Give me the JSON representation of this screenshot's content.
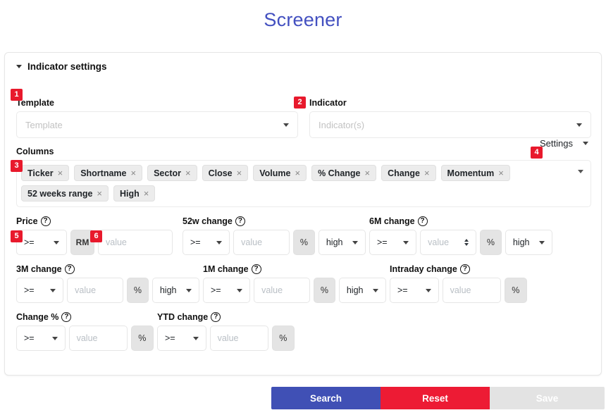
{
  "page": {
    "title": "Screener"
  },
  "card": {
    "header": "Indicator settings",
    "settings_label": "Settings"
  },
  "badges": {
    "b1": "1",
    "b2": "2",
    "b3": "3",
    "b4": "4",
    "b5": "5",
    "b6": "6"
  },
  "template": {
    "label": "Template",
    "placeholder": "Template",
    "value": ""
  },
  "indicator": {
    "label": "Indicator",
    "placeholder": "Indicator(s)",
    "value": ""
  },
  "columns": {
    "label": "Columns",
    "tags": [
      {
        "label": "Ticker",
        "remove": "×"
      },
      {
        "label": "Shortname",
        "remove": "×"
      },
      {
        "label": "Sector",
        "remove": "×"
      },
      {
        "label": "Close",
        "remove": "×"
      },
      {
        "label": "Volume",
        "remove": "×"
      },
      {
        "label": "% Change",
        "remove": "×"
      },
      {
        "label": "Change",
        "remove": "×"
      },
      {
        "label": "Momentum",
        "remove": "×"
      },
      {
        "label": "52 weeks range",
        "remove": "×"
      },
      {
        "label": "High",
        "remove": "×"
      }
    ]
  },
  "filters": {
    "price": {
      "label": "Price",
      "help": "?",
      "op": ">=",
      "unit": "RM",
      "value_placeholder": "value"
    },
    "w52": {
      "label": "52w change",
      "help": "?",
      "op": ">=",
      "unit": "%",
      "value_placeholder": "value",
      "hl": "high"
    },
    "m6": {
      "label": "6M change",
      "help": "?",
      "op": ">=",
      "unit": "%",
      "value_placeholder": "value",
      "hl": "high"
    },
    "m3": {
      "label": "3M change",
      "help": "?",
      "op": ">=",
      "unit": "%",
      "value_placeholder": "value",
      "hl": "high"
    },
    "m1": {
      "label": "1M change",
      "help": "?",
      "op": ">=",
      "unit": "%",
      "value_placeholder": "value",
      "hl": "high"
    },
    "intraday": {
      "label": "Intraday change",
      "help": "?",
      "op": ">=",
      "unit": "%",
      "value_placeholder": "value"
    },
    "changepc": {
      "label": "Change %",
      "help": "?",
      "op": ">=",
      "unit": "%",
      "value_placeholder": "value"
    },
    "ytd": {
      "label": "YTD change",
      "help": "?",
      "op": ">=",
      "unit": "%",
      "value_placeholder": "value"
    }
  },
  "actions": {
    "search": "Search",
    "reset": "Reset",
    "save": "Save"
  },
  "colors": {
    "title": "#4350c0",
    "badge": "#e8192c",
    "search": "#4050b5",
    "reset": "#ed1b34",
    "save": "#e3e3e3"
  }
}
